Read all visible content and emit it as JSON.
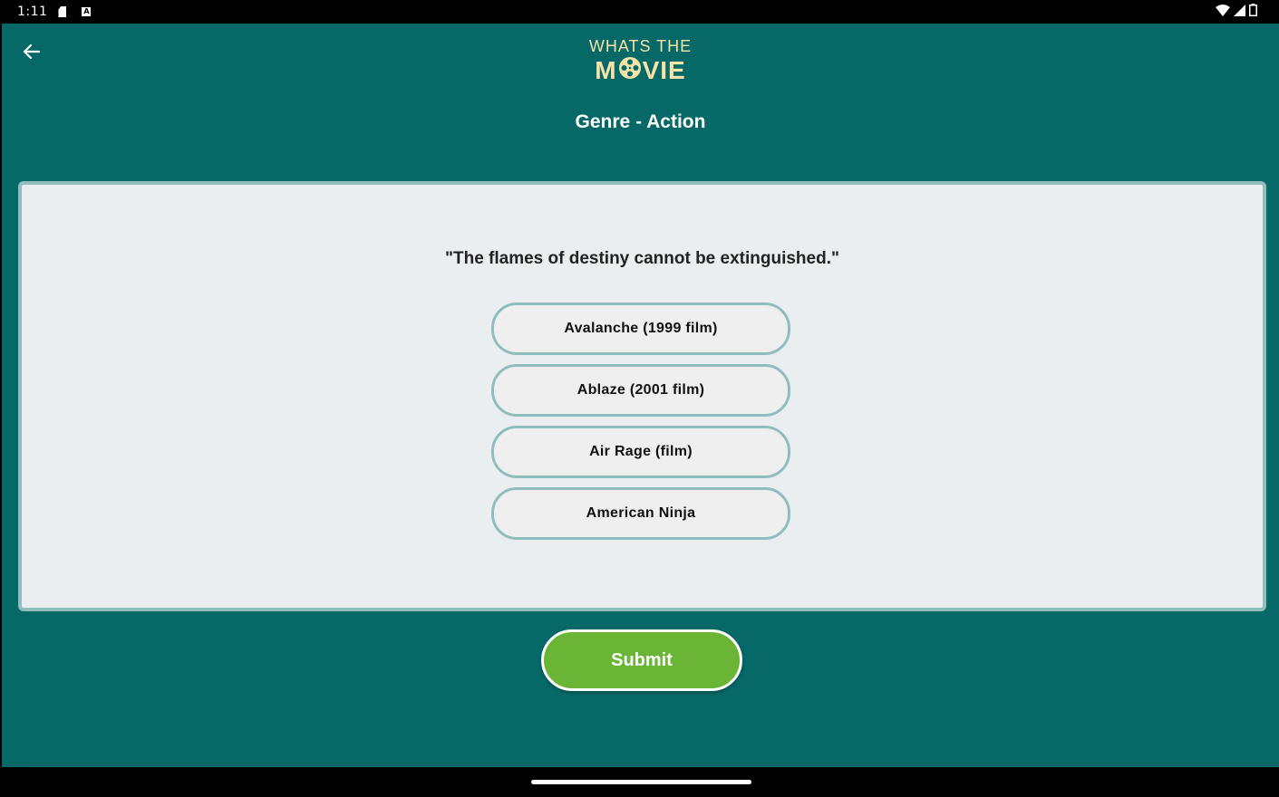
{
  "status_bar": {
    "time": "1:11",
    "icons": [
      "sd-card-icon",
      "a-notification-icon",
      "wifi-icon",
      "signal-icon",
      "battery-icon"
    ]
  },
  "header": {
    "back_icon": "arrow-left-icon",
    "logo_line1": "WHATS THE",
    "logo_line2_left": "M",
    "logo_line2_right": "VIE",
    "genre_title": "Genre - Action"
  },
  "question": {
    "quote": "\"The flames of destiny cannot be extinguished.\"",
    "options": [
      {
        "label": "Avalanche (1999 film)"
      },
      {
        "label": "Ablaze (2001 film)"
      },
      {
        "label": "Air Rage (film)"
      },
      {
        "label": "American Ninja"
      }
    ]
  },
  "actions": {
    "submit_label": "Submit"
  },
  "colors": {
    "background": "#066968",
    "card": "#eaeef1",
    "card_border": "#8fbebc",
    "logo": "#f5e3a8",
    "submit": "#6ab535"
  }
}
